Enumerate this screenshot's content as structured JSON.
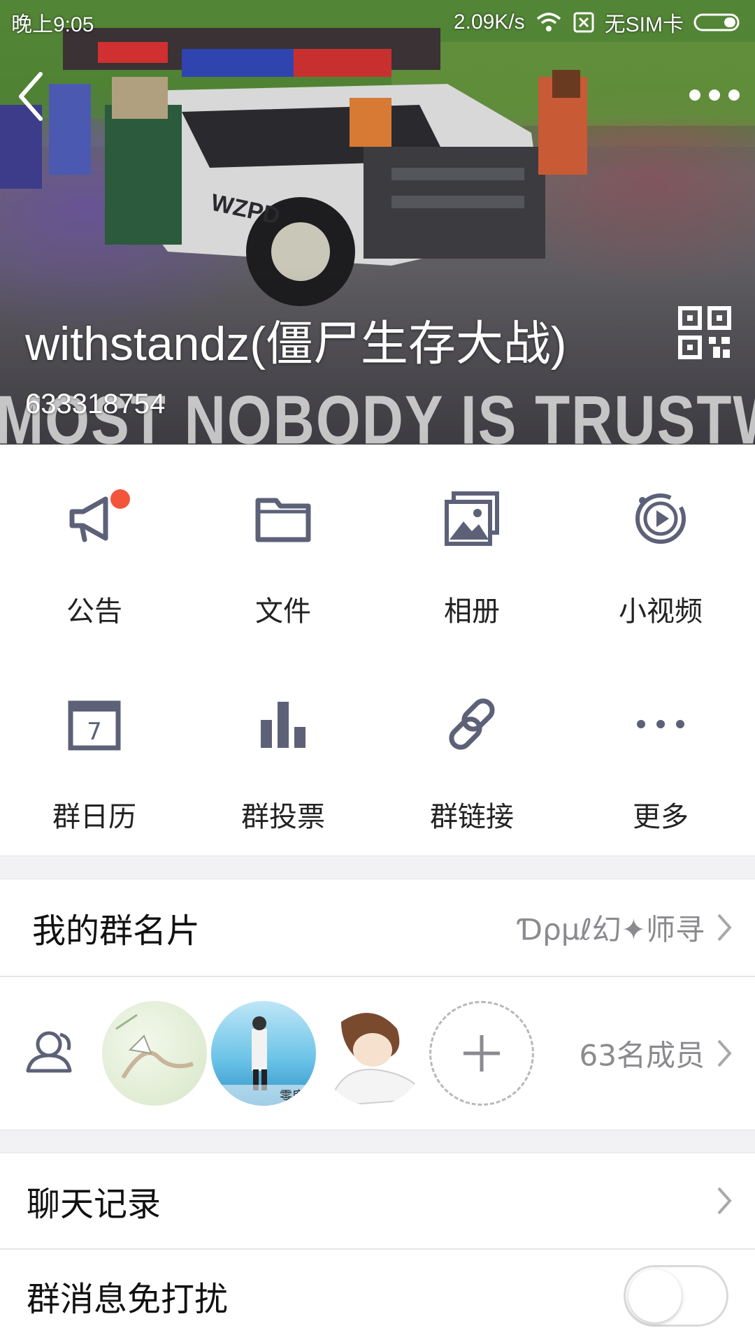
{
  "status_bar": {
    "time": "晚上9:05",
    "net_speed": "2.09K/s",
    "sim": "无SIM卡",
    "icons": [
      "wifi-icon",
      "no-sim-icon",
      "battery-icon"
    ]
  },
  "header": {
    "group_name": "withstandz(僵尸生存大战)",
    "group_id": "633318754",
    "cover_slogan": "MOST NOBODY IS TRUSTWORT",
    "cover_vehicle_text": "WZPD",
    "icons": [
      "back-icon",
      "more-icon",
      "qr-code-icon"
    ]
  },
  "features": [
    {
      "label": "公告",
      "icon": "megaphone-icon",
      "badge": true
    },
    {
      "label": "文件",
      "icon": "folder-icon"
    },
    {
      "label": "相册",
      "icon": "album-icon"
    },
    {
      "label": "小视频",
      "icon": "video-icon"
    },
    {
      "label": "群日历",
      "icon": "calendar-icon",
      "icon_text": "7"
    },
    {
      "label": "群投票",
      "icon": "poll-icon"
    },
    {
      "label": "群链接",
      "icon": "link-icon"
    },
    {
      "label": "更多",
      "icon": "more-dots-icon"
    }
  ],
  "my_card": {
    "title": "我的群名片",
    "value": "Ɗρµℓ幻✦师寻"
  },
  "members": {
    "count_label": "63名成员",
    "avatar_caption": "零度",
    "icons": [
      "members-icon",
      "add-member-icon"
    ]
  },
  "chat_history": {
    "title": "聊天记录"
  },
  "mute": {
    "title": "群消息免打扰",
    "enabled": false
  },
  "colors": {
    "badge": "#f3553a",
    "icon": "#5d6178",
    "separator": "#f2f2f4"
  }
}
